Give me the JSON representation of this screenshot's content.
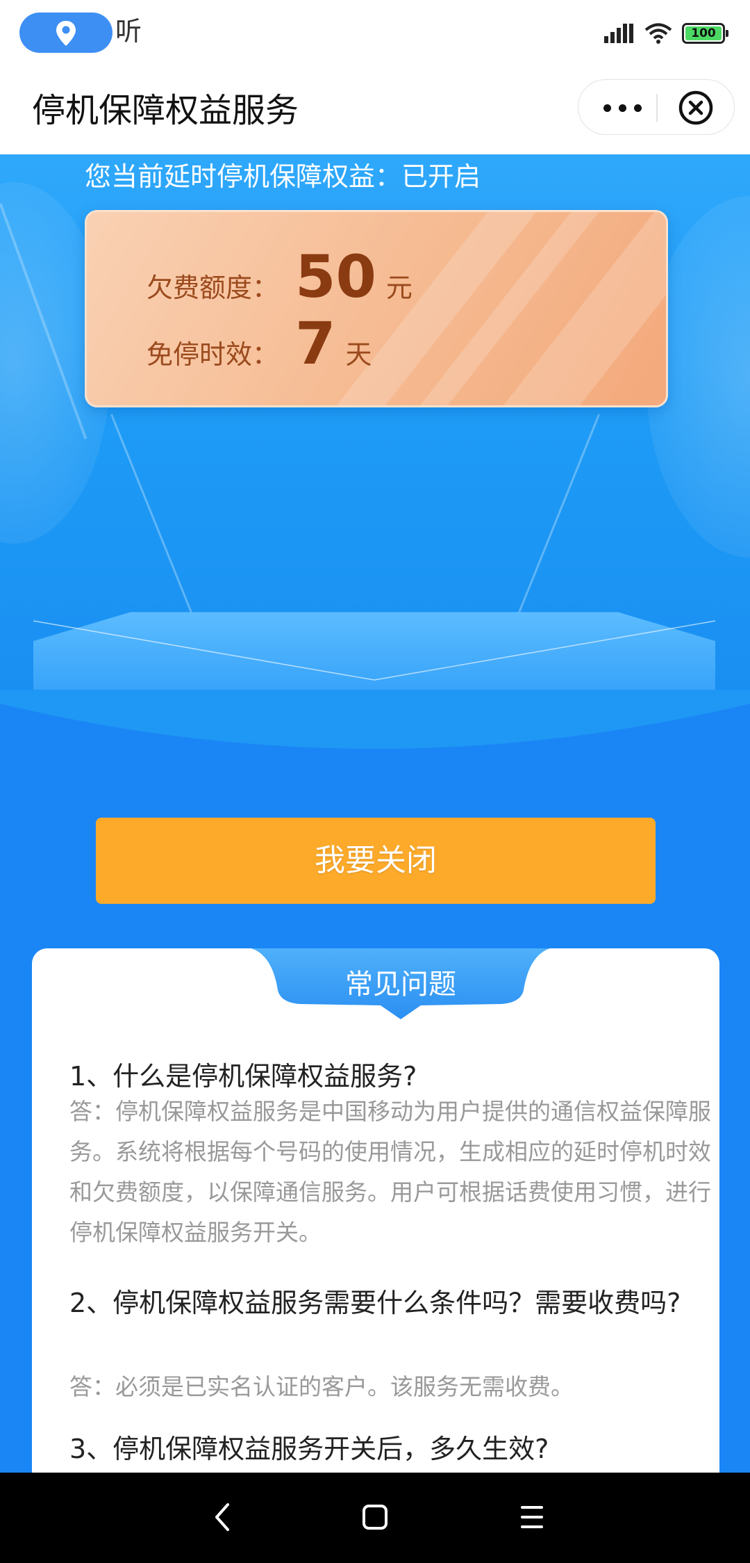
{
  "status_bar": {
    "listen_label": "听",
    "battery": "100"
  },
  "nav": {
    "title": "停机保障权益服务"
  },
  "hero": {
    "status_text": "您当前延时停机保障权益：已开启",
    "debt_label": "欠费额度：",
    "debt_value": "50",
    "debt_unit": "元",
    "grace_label": "免停时效：",
    "grace_value": "7",
    "grace_unit": "天"
  },
  "actions": {
    "close_label": "我要关闭"
  },
  "faq": {
    "title": "常见问题",
    "items": [
      {
        "question": "1、什么是停机保障权益服务?",
        "answer": "答：停机保障权益服务是中国移动为用户提供的通信权益保障服务。系统将根据每个号码的使用情况，生成相应的延时停机时效和欠费额度，以保障通信服务。用户可根据话费使用习惯，进行停机保障权益服务开关。"
      },
      {
        "question": "2、停机保障权益服务需要什么条件吗？需要收费吗?",
        "answer": "答：必须是已实名认证的客户。该服务无需收费。"
      },
      {
        "question": "3、停机保障权益服务开关后，多久生效?",
        "answer": ""
      }
    ]
  },
  "colors": {
    "accent_blue": "#1a86f5",
    "button_orange": "#fdaa2a",
    "card_peach": "#f6bc94"
  }
}
